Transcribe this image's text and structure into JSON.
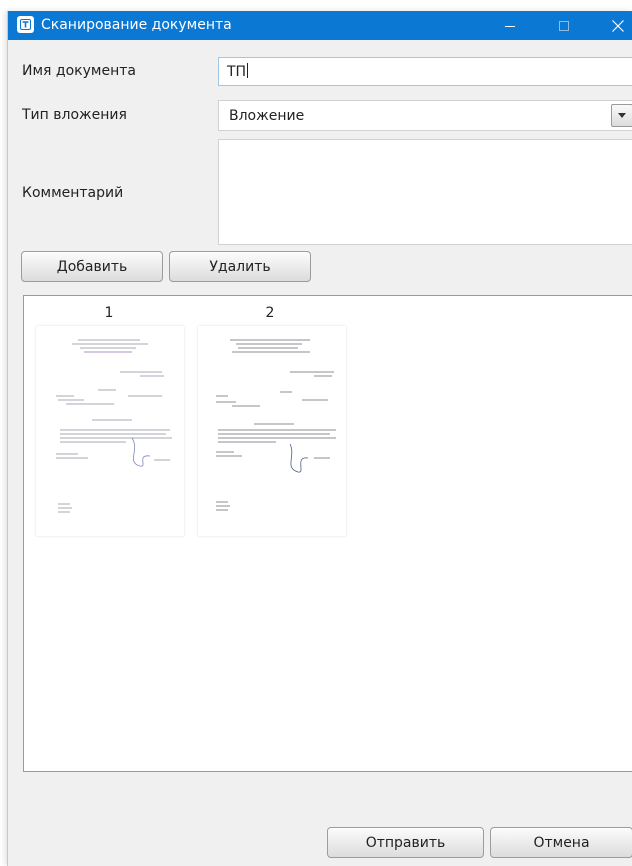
{
  "window": {
    "title": "Сканирование документа",
    "accent_color": "#0b78d4",
    "icon": "app-t-icon"
  },
  "form": {
    "name_label": "Имя документа",
    "name_value": "ТП",
    "type_label": "Тип вложения",
    "type_value": "Вложение",
    "comment_label": "Комментарий",
    "comment_value": ""
  },
  "actions": {
    "add_label": "Добавить",
    "delete_label": "Удалить",
    "send_label": "Отправить",
    "cancel_label": "Отмена"
  },
  "pages": [
    {
      "number": "1",
      "thumbnail": "scanned-page-thumbnail"
    },
    {
      "number": "2",
      "thumbnail": "scanned-page-thumbnail"
    }
  ]
}
